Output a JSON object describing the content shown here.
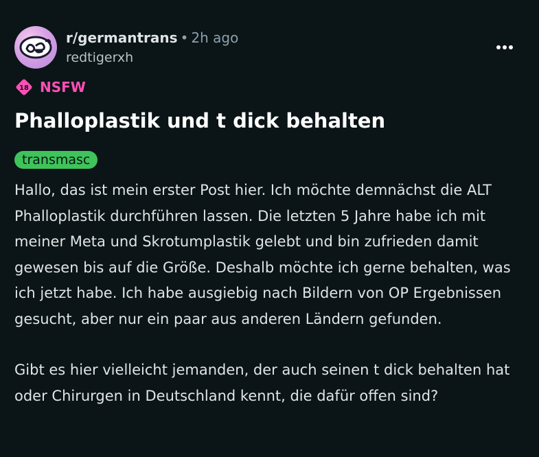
{
  "post": {
    "subreddit": "r/germantrans",
    "separator": "•",
    "time": "2h ago",
    "author": "redtigerxh",
    "more_label": "•••",
    "nsfw": {
      "badge_text": "18",
      "label": "NSFW",
      "color": "#ff4fb6"
    },
    "title": "Phalloplastik und t dick behalten",
    "flair": {
      "label": "transmasc",
      "color": "#3fc35b"
    },
    "paragraphs": [
      "Hallo, das ist mein erster Post hier. Ich möchte demnächst die ALT Phalloplastik durchführen lassen. Die letzten 5 Jahre habe ich mit meiner Meta und Skrotumplastik gelebt und bin zufrieden damit gewesen bis auf die Größe. Deshalb möchte ich gerne behalten, was ich jetzt habe. Ich habe ausgiebig nach Bildern von OP Ergebnissen gesucht, aber nur ein paar aus anderen Ländern gefunden.",
      "Gibt es hier vielleicht jemanden, der auch seinen t dick behalten hat oder Chirurgen in Deutschland kennt, die dafür offen sind?"
    ],
    "avatar_icon": "community-avatar-icon"
  },
  "colors": {
    "background": "#0b1416",
    "text": "#dfe5e7",
    "muted": "#8ba2ad"
  }
}
